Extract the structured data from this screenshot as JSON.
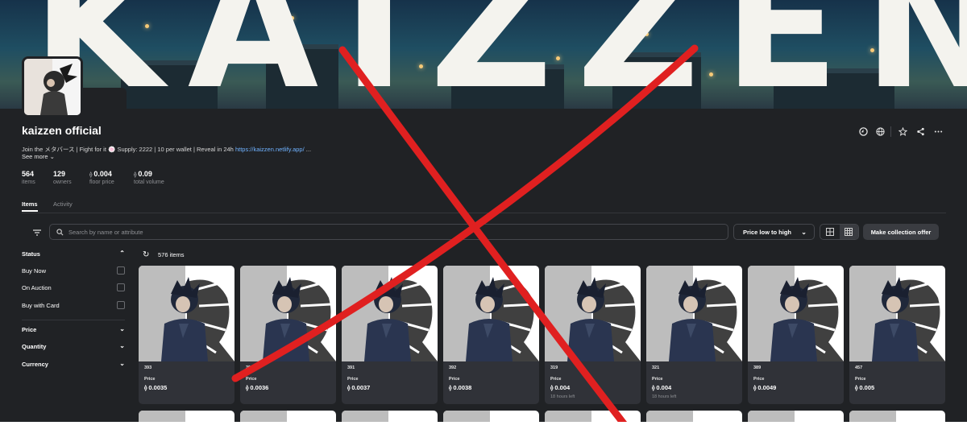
{
  "banner": {
    "text": "KAIZZEN"
  },
  "collection": {
    "title": "kaizzen official",
    "description_text": "Join the メタバース | Fight for it 🍥 Supply: 2222 | 10 per wallet | Reveal in 24h ",
    "description_link": "https://kaizzen.netlify.app/",
    "description_ellipsis": " ...",
    "see_more": "See more ⌄"
  },
  "header_icons": [
    "opensea-icon",
    "globe-icon",
    "star-icon",
    "share-icon",
    "more-icon"
  ],
  "stats": [
    {
      "value": "564",
      "label": "items"
    },
    {
      "value": "129",
      "label": "owners"
    },
    {
      "value": "0.004",
      "label": "floor price",
      "eth": true
    },
    {
      "value": "0.09",
      "label": "total volume",
      "eth": true
    }
  ],
  "tabs": {
    "items": "Items",
    "activity": "Activity"
  },
  "toolbar": {
    "search_placeholder": "Search by name or attribute",
    "sort_label": "Price low to high",
    "offer_label": "Make collection offer"
  },
  "sidebar": {
    "status": "Status",
    "options": [
      "Buy Now",
      "On Auction",
      "Buy with Card"
    ],
    "price": "Price",
    "quantity": "Quantity",
    "currency": "Currency"
  },
  "results": {
    "count": "576 items"
  },
  "cards": [
    {
      "id": "393",
      "price_label": "Price",
      "price": "0.0035",
      "time": ""
    },
    {
      "id": "390",
      "price_label": "Price",
      "price": "0.0036",
      "time": ""
    },
    {
      "id": "391",
      "price_label": "Price",
      "price": "0.0037",
      "time": ""
    },
    {
      "id": "392",
      "price_label": "Price",
      "price": "0.0038",
      "time": ""
    },
    {
      "id": "319",
      "price_label": "Price",
      "price": "0.004",
      "time": "18 hours left"
    },
    {
      "id": "321",
      "price_label": "Price",
      "price": "0.004",
      "time": "18 hours left"
    },
    {
      "id": "389",
      "price_label": "Price",
      "price": "0.0049",
      "time": ""
    },
    {
      "id": "457",
      "price_label": "Price",
      "price": "0.005",
      "time": ""
    }
  ],
  "colors": {
    "background": "#202225",
    "card": "#303238",
    "overlay_x": "#e02020",
    "link": "#6fb2ff"
  }
}
